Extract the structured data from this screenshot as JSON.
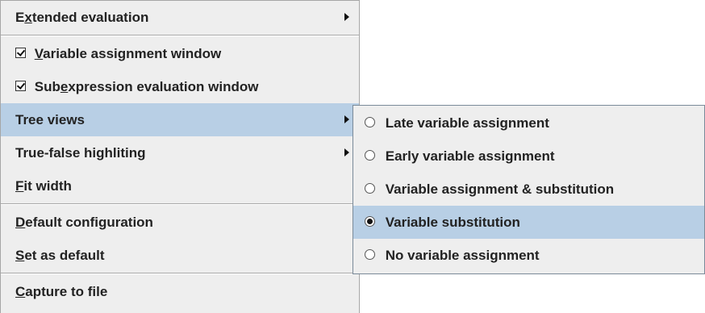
{
  "main_menu": {
    "items": [
      {
        "pre": "E",
        "u": "x",
        "post": "tended evaluation",
        "submenu": true
      },
      {
        "check": true,
        "pre": "",
        "u": "V",
        "post": "ariable assignment window"
      },
      {
        "check": true,
        "pre": "Sub",
        "u": "e",
        "post": "xpression evaluation window"
      },
      {
        "label": "Tree views",
        "submenu": true,
        "selected": true
      },
      {
        "label": "True-false highliting",
        "submenu": true
      },
      {
        "pre": "",
        "u": "F",
        "post": "it width"
      },
      {
        "pre": "",
        "u": "D",
        "post": "efault configuration"
      },
      {
        "pre": "",
        "u": "S",
        "post": "et as default"
      },
      {
        "pre": "",
        "u": "C",
        "post": "apture to file"
      }
    ]
  },
  "submenu": {
    "items": [
      {
        "label": "Late variable assignment",
        "checked": false
      },
      {
        "label": "Early variable assignment",
        "checked": false
      },
      {
        "label": "Variable assignment & substitution",
        "checked": false
      },
      {
        "label": "Variable substitution",
        "checked": true
      },
      {
        "label": "No variable assignment",
        "checked": false
      }
    ]
  },
  "icons": {
    "submenu_arrow": "triangle-right-icon",
    "checkbox": "checkbox-checked-icon",
    "radio": "radio-button-icon"
  },
  "colors": {
    "menu_bg": "#eeeeee",
    "selection": "#b8cfe5",
    "text": "#222222"
  }
}
